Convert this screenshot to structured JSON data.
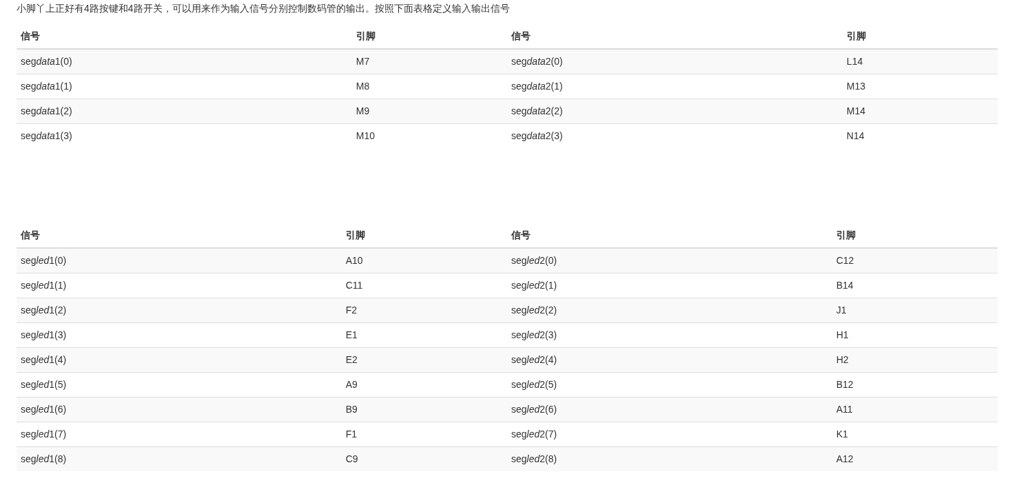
{
  "intro": "小脚丫上正好有4路按键和4路开关，可以用来作为输入信号分别控制数码管的输出。按照下面表格定义输入输出信号",
  "tables": [
    {
      "columns": [
        "信号",
        "引脚",
        "信号",
        "引脚"
      ],
      "rows": [
        [
          [
            "seg",
            "data",
            "1(0)"
          ],
          "M7",
          [
            "seg",
            "data",
            "2(0)"
          ],
          "L14"
        ],
        [
          [
            "seg",
            "data",
            "1(1)"
          ],
          "M8",
          [
            "seg",
            "data",
            "2(1)"
          ],
          "M13"
        ],
        [
          [
            "seg",
            "data",
            "1(2)"
          ],
          "M9",
          [
            "seg",
            "data",
            "2(2)"
          ],
          "M14"
        ],
        [
          [
            "seg",
            "data",
            "1(3)"
          ],
          "M10",
          [
            "seg",
            "data",
            "2(3)"
          ],
          "N14"
        ]
      ]
    },
    {
      "columns": [
        "信号",
        "引脚",
        "信号",
        "引脚"
      ],
      "rows": [
        [
          [
            "seg",
            "led",
            "1(0)"
          ],
          "A10",
          [
            "seg",
            "led",
            "2(0)"
          ],
          "C12"
        ],
        [
          [
            "seg",
            "led",
            "1(1)"
          ],
          "C11",
          [
            "seg",
            "led",
            "2(1)"
          ],
          "B14"
        ],
        [
          [
            "seg",
            "led",
            "1(2)"
          ],
          "F2",
          [
            "seg",
            "led",
            "2(2)"
          ],
          "J1"
        ],
        [
          [
            "seg",
            "led",
            "1(3)"
          ],
          "E1",
          [
            "seg",
            "led",
            "2(3)"
          ],
          "H1"
        ],
        [
          [
            "seg",
            "led",
            "1(4)"
          ],
          "E2",
          [
            "seg",
            "led",
            "2(4)"
          ],
          "H2"
        ],
        [
          [
            "seg",
            "led",
            "1(5)"
          ],
          "A9",
          [
            "seg",
            "led",
            "2(5)"
          ],
          "B12"
        ],
        [
          [
            "seg",
            "led",
            "1(6)"
          ],
          "B9",
          [
            "seg",
            "led",
            "2(6)"
          ],
          "A11"
        ],
        [
          [
            "seg",
            "led",
            "1(7)"
          ],
          "F1",
          [
            "seg",
            "led",
            "2(7)"
          ],
          "K1"
        ],
        [
          [
            "seg",
            "led",
            "1(8)"
          ],
          "C9",
          [
            "seg",
            "led",
            "2(8)"
          ],
          "A12"
        ]
      ]
    }
  ]
}
